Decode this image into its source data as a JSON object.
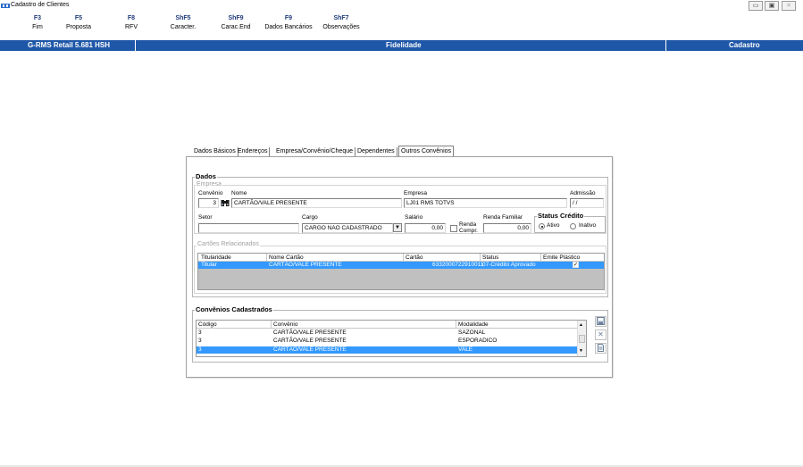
{
  "window": {
    "title": "Cadastro de Clientes",
    "controls": [
      "minimize",
      "restore",
      "close"
    ]
  },
  "fkeys": [
    {
      "key": "F3",
      "label": "Fim"
    },
    {
      "key": "F5",
      "label": "Proposta"
    },
    {
      "key": "F8",
      "label": "RFV"
    },
    {
      "key": "ShF5",
      "label": "Caracter."
    },
    {
      "key": "ShF9",
      "label": "Carac.End"
    },
    {
      "key": "F9",
      "label": "Dados Bancários"
    },
    {
      "key": "ShF7",
      "label": "Observações"
    }
  ],
  "statusbar": {
    "product": "G-RMS Retail 5.681 HSH",
    "module": "Fidelidade",
    "mode": "Cadastro",
    "color": "#1f57a8"
  },
  "tabs": [
    "Dados Básicos",
    "Endereços",
    "Empresa/Convênio/Cheque",
    "Dependentes",
    "Outros Convênios"
  ],
  "active_tab": "Outros Convênios",
  "dados": {
    "group_title": "Dados",
    "empresa_title": "Empresa",
    "labels": {
      "convenio": "Convênio",
      "nome": "Nome",
      "empresa": "Empresa",
      "admissao": "Admissão",
      "setor": "Setor",
      "cargo": "Cargo",
      "salario": "Salário",
      "renda_compr": "Renda Compr.",
      "renda_familiar": "Renda Familiar"
    },
    "values": {
      "convenio": "3",
      "nome": "CARTÃO/VALE PRESENTE",
      "empresa": "LJ01 RMS TOTVS",
      "admissao": "/ /",
      "setor": "",
      "cargo": "CARGO NAO CADASTRADO",
      "salario": "0,00",
      "renda_familiar": "0,00"
    },
    "status_credito": {
      "title": "Status Crédito",
      "options": [
        "Ativo",
        "Inativo"
      ],
      "selected": "Ativo"
    }
  },
  "cartoes": {
    "title": "Cartões Relacionados",
    "columns": [
      "Titularidade",
      "Nome Cartão",
      "Cartão",
      "Status",
      "Emite Plástico"
    ],
    "rows": [
      {
        "titularidade": "Titular",
        "nome": "CARTÃO/VALE PRESENTE",
        "cartao": "6332000722910011",
        "status": "07-Crédito Aprovado",
        "emite": true
      }
    ]
  },
  "convenios": {
    "title": "Convênios Cadastrados",
    "columns": [
      "Código",
      "Convênio",
      "Modalidade"
    ],
    "rows": [
      {
        "codigo": "3",
        "convenio": "CARTÃO/VALE PRESENTE",
        "modalidade": "SAZONAL"
      },
      {
        "codigo": "3",
        "convenio": "CARTÃO/VALE PRESENTE",
        "modalidade": "ESPORADICO"
      },
      {
        "codigo": "3",
        "convenio": "CARTÃO/VALE PRESENTE",
        "modalidade": "VALE"
      }
    ],
    "selected_row": 2,
    "side_buttons": [
      "save-icon",
      "delete-icon",
      "new-document-icon"
    ]
  },
  "colors": {
    "selection": "#3399ff",
    "fkey": "#1f3a7a"
  }
}
